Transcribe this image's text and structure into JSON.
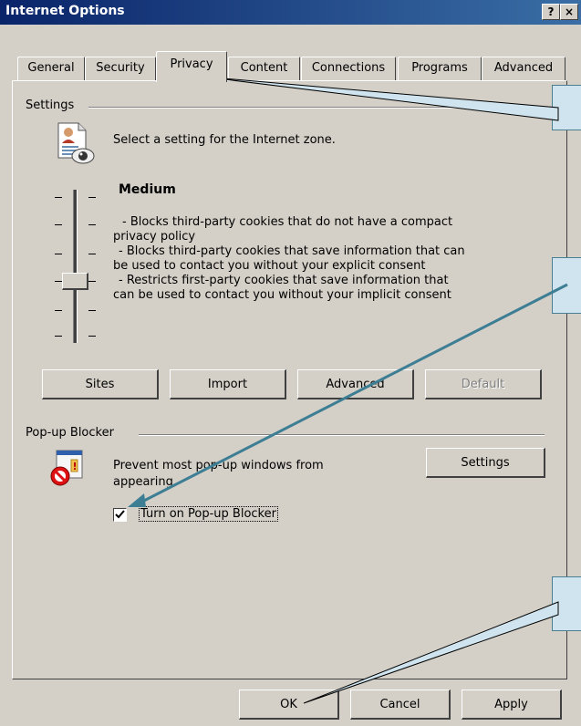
{
  "window": {
    "title": "Internet Options",
    "help_button": "?",
    "close_button": "×"
  },
  "tabs": [
    {
      "label": "General",
      "active": false
    },
    {
      "label": "Security",
      "active": false
    },
    {
      "label": "Privacy",
      "active": true
    },
    {
      "label": "Content",
      "active": false
    },
    {
      "label": "Connections",
      "active": false
    },
    {
      "label": "Programs",
      "active": false
    },
    {
      "label": "Advanced",
      "active": false
    }
  ],
  "settings": {
    "group_label": "Settings",
    "zone_text": "Select a setting for the Internet zone.",
    "level": "Medium",
    "description_lines": [
      "- Blocks third-party cookies that do not have a compact",
      "privacy policy",
      "- Blocks third-party cookies that save information that can",
      "be used to contact you without your explicit consent",
      "- Restricts first-party cookies that save information that",
      "can be used to contact you without your implicit consent"
    ],
    "slider_level_index": 3,
    "slider_level_count": 6,
    "buttons": {
      "sites": "Sites",
      "import": "Import",
      "advanced": "Advanced",
      "default": "Default"
    }
  },
  "popup": {
    "group_label": "Pop-up Blocker",
    "description_line1": "Prevent most pop-up windows from",
    "description_line2": "appearing.",
    "settings_button": "Settings",
    "checkbox_label": "Turn on Pop-up Blocker",
    "checkbox_checked": true
  },
  "footer": {
    "ok": "OK",
    "cancel": "Cancel",
    "apply": "Apply"
  },
  "colors": {
    "title_bar": "#0a246a",
    "dialog_face": "#d4d0c8",
    "callout_fill": "#cfe4ee",
    "arrow": "#3d7e95"
  }
}
